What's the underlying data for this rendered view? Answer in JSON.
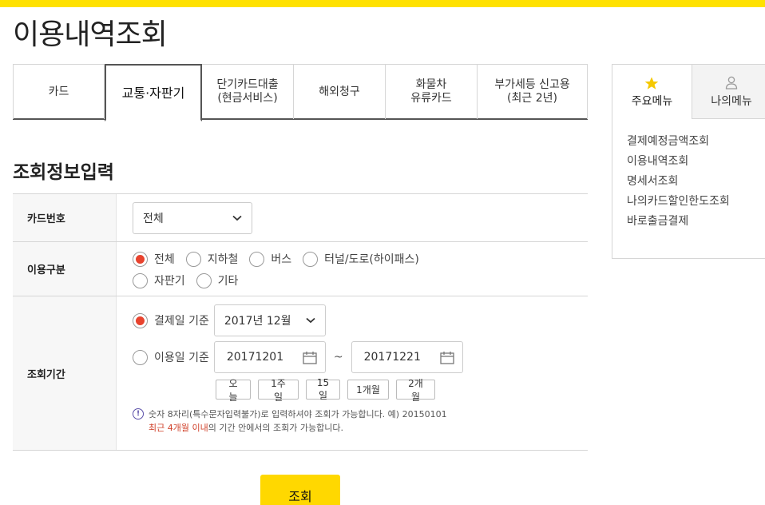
{
  "page_title": "이용내역조회",
  "tabs": [
    {
      "label_1": "카드",
      "label_2": ""
    },
    {
      "label_1": "교통·자판기",
      "label_2": ""
    },
    {
      "label_1": "단기카드대출",
      "label_2": "(현금서비스)"
    },
    {
      "label_1": "해외청구",
      "label_2": ""
    },
    {
      "label_1": "화물차",
      "label_2": "유류카드"
    },
    {
      "label_1": "부가세등 신고용",
      "label_2": "(최근 2년)"
    }
  ],
  "active_tab": 1,
  "section_title": "조회정보입력",
  "form": {
    "card_number": {
      "label": "카드번호",
      "selected": "전체"
    },
    "usage_type": {
      "label": "이용구분",
      "options": [
        "전체",
        "지하철",
        "버스",
        "터널/도로(하이패스)",
        "자판기",
        "기타"
      ],
      "selected": "전체"
    },
    "period": {
      "label": "조회기간",
      "billing_label": "결제일 기준",
      "billing_month": "2017년 12월",
      "usage_label": "이용일 기준",
      "start_date": "20171201",
      "end_date": "20171221",
      "tilde": "~",
      "quick_buttons": [
        "오늘",
        "1주일",
        "15일",
        "1개월",
        "2개월"
      ],
      "notice_line1": "숫자 8자리(특수문자입력불가)로 입력하셔야 조회가 가능합니다. 예) 20150101",
      "notice_line2_red": "최근 4개월 이내",
      "notice_line2_rest": "의 기간 안에서의 조회가 가능합니다."
    }
  },
  "search_button": "조회",
  "sidebar": {
    "tab_main": "주요메뉴",
    "tab_my": "나의메뉴",
    "links": [
      "결제예정금액조회",
      "이용내역조회",
      "명세서조회",
      "나의카드할인한도조회",
      "바로출금결제"
    ]
  },
  "colors": {
    "accent_yellow": "#ffd800",
    "radio_red": "#e8432e",
    "notice_red": "#d0412a"
  }
}
